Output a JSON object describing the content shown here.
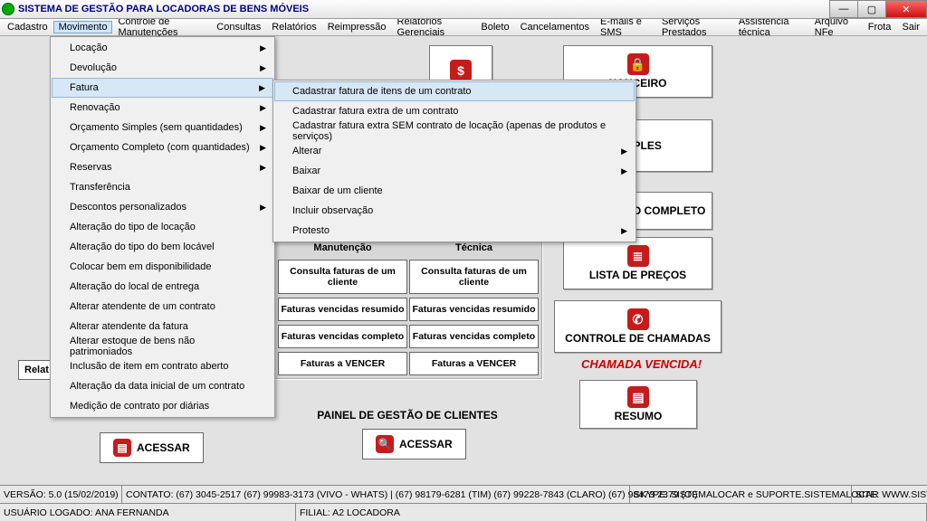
{
  "title": "SISTEMA DE GESTÃO PARA LOCADORAS DE BENS MÓVEIS",
  "menubar": [
    "Cadastro",
    "Movimento",
    "Controle de Manutenções",
    "Consultas",
    "Relatórios",
    "Reimpressão",
    "Relatórios Gerenciais",
    "Boleto",
    "Cancelamentos",
    "E-mails e SMS",
    "Serviços Prestados",
    "Assistência técnica",
    "Arquivo NFe",
    "Frota",
    "Sair"
  ],
  "drop1": [
    {
      "l": "Locação",
      "a": true
    },
    {
      "l": "Devolução",
      "a": true
    },
    {
      "l": "Fatura",
      "a": true,
      "hov": true
    },
    {
      "l": "Renovação",
      "a": true
    },
    {
      "l": "Orçamento Simples (sem quantidades)",
      "a": true
    },
    {
      "l": "Orçamento Completo (com quantidades)",
      "a": true
    },
    {
      "l": "Reservas",
      "a": true
    },
    {
      "l": "Transferência"
    },
    {
      "l": "Descontos personalizados",
      "a": true
    },
    {
      "l": "Alteração do tipo de locação"
    },
    {
      "l": "Alteração do tipo do bem locável"
    },
    {
      "l": "Colocar bem em disponibilidade"
    },
    {
      "l": "Alteração do local de entrega"
    },
    {
      "l": "Alterar atendente de um contrato"
    },
    {
      "l": "Alterar atendente da fatura"
    },
    {
      "l": "Alterar estoque de bens não patrimoniados"
    },
    {
      "l": "Inclusão de item em contrato aberto"
    },
    {
      "l": "Alteração da data inicial de um contrato"
    },
    {
      "l": "Medição de contrato por diárias"
    }
  ],
  "drop2": [
    {
      "l": "Cadastrar fatura de itens de um contrato",
      "hov": true
    },
    {
      "l": "Cadastrar fatura extra de um contrato"
    },
    {
      "l": "Cadastrar fatura extra SEM contrato de locação (apenas de produtos e serviços)"
    },
    {
      "l": "Alterar",
      "a": true
    },
    {
      "l": "Baixar",
      "a": true
    },
    {
      "l": "Baixar de um cliente"
    },
    {
      "l": "Incluir observação"
    },
    {
      "l": "Protesto",
      "a": true
    }
  ],
  "bigbuttons": {
    "financeiro": "NANCEIRO",
    "simples": "SIMPLES",
    "orc_completo": "ORÇAMENTO COMPLETO",
    "lista": "LISTA DE PREÇOS",
    "chamadas": "CONTROLE DE CHAMADAS",
    "resumo": "RESUMO"
  },
  "chamada_vencida": "CHAMADA VENCIDA!",
  "panel": {
    "h1": "Locação, Extra e Manutenção",
    "h2": "Serviços e Assistência Técnica",
    "rows": [
      [
        "Consulta faturas de um cliente",
        "Consulta faturas de um cliente"
      ],
      [
        "Faturas vencidas resumido",
        "Faturas vencidas resumido"
      ],
      [
        "Faturas vencidas completo",
        "Faturas vencidas completo"
      ],
      [
        "Faturas a VENCER",
        "Faturas a VENCER"
      ]
    ]
  },
  "painel_clientes": "PAINEL DE GESTÃO DE CLIENTES",
  "acessar": "ACESSAR",
  "relat": "Relat",
  "status": {
    "versao": "VERSÃO: 5.0 (15/02/2019)",
    "contato": "CONTATO: (67) 3045-2517 (67) 99983-3173 (VIVO - WHATS) | (67) 98179-6281 (TIM) (67) 99228-7843 (CLARO) (67) 98473-2379 (OI)",
    "skype": "SKYPE: SISTEMALOCAR e SUPORTE.SISTEMALOCAR",
    "site": "SITE: WWW.SISTEMALOCAR.COM.BR",
    "usuario": "USUÁRIO LOGADO: ANA FERNANDA",
    "filial": "FILIAL: A2 LOCADORA"
  },
  "icons": {
    "dollar": "$",
    "lock": "🔒",
    "list": "≣",
    "phone": "✆",
    "doc": "▤",
    "search": "🔍"
  }
}
